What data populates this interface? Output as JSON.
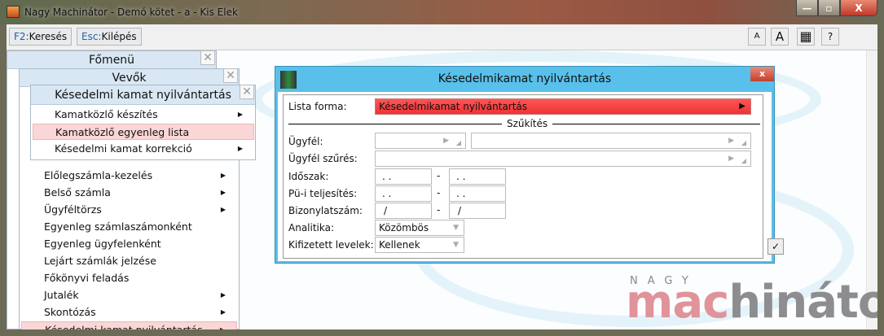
{
  "window": {
    "title": "Nagy Machinátor - Demó kötet - a - Kis Elek",
    "minimize": "—",
    "maximize": "▫",
    "close": "X"
  },
  "toolbar": {
    "search_key": "F2:",
    "search_label": "Keresés",
    "exit_key": "Esc:",
    "exit_label": "Kilépés",
    "font_small": "A",
    "font_large": "A",
    "grid": "▦",
    "help": "?"
  },
  "panels": {
    "main": {
      "title": "Főmenü",
      "close": "✕"
    },
    "vevok": {
      "title": "Vevők",
      "close": "✕",
      "items": [
        {
          "label": "Előlegszámla-kezelés",
          "sub": true
        },
        {
          "label": "Belső számla",
          "sub": true
        },
        {
          "label": "Ügyféltörzs",
          "sub": true
        },
        {
          "label": "Egyenleg számlaszámonként",
          "sub": false
        },
        {
          "label": "Egyenleg ügyfelenként",
          "sub": false
        },
        {
          "label": "Lejárt számlák jelzése",
          "sub": false
        },
        {
          "label": "Főkönyvi feladás",
          "sub": false
        },
        {
          "label": "Jutalék",
          "sub": true
        },
        {
          "label": "Skontózás",
          "sub": true
        },
        {
          "label": "Késedelmi kamat nyilvántartás",
          "sub": true
        }
      ]
    },
    "kesedelmi": {
      "title": "Késedelmi kamat nyilvántartás",
      "close": "✕",
      "items": [
        {
          "label": "Kamatközlő készítés",
          "sub": true
        },
        {
          "label": "Kamatközlő egyenleg lista",
          "sub": false
        },
        {
          "label": "Késedelmi kamat korrekció",
          "sub": true
        }
      ]
    }
  },
  "dialog": {
    "title": "Késedelmikamat nyilvántartás",
    "close": "x",
    "section": "Szűkítés",
    "dash": "-",
    "ok": "✓",
    "fields": {
      "lista_forma": {
        "label": "Lista forma:",
        "value": "Késedelmikamat nyilvántartás"
      },
      "ugyfel": {
        "label": "Ügyfél:"
      },
      "ugyfel_szures": {
        "label": "Ügyfél szűrés:"
      },
      "idoszak": {
        "label": "Időszak:",
        "from": ". .",
        "to": ". ."
      },
      "pu_teljesites": {
        "label": "Pü-i teljesítés:",
        "from": ". .",
        "to": ". ."
      },
      "bizonylatszam": {
        "label": "Bizonylatszám:",
        "from": "/",
        "to": "/"
      },
      "analitika": {
        "label": "Analitika:",
        "value": "Közömbös"
      },
      "kifizetett": {
        "label": "Kifizetett levelek:",
        "value": "Kellenek"
      }
    }
  },
  "logo": {
    "top": "NAGY",
    "a": "mac",
    "b": "hinátor"
  },
  "colors": {
    "accent": "#58c0ea",
    "highlight": "#fbd6d6",
    "lista": "#ee4444"
  }
}
